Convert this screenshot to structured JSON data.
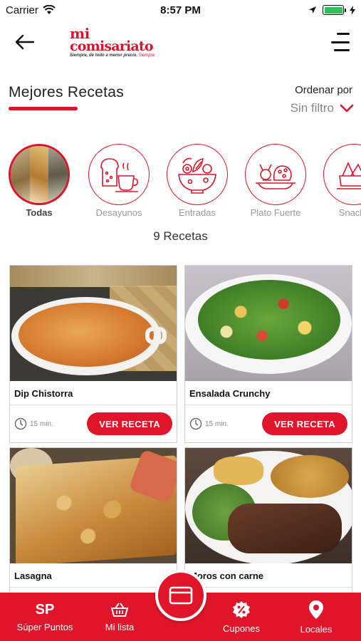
{
  "status_bar": {
    "carrier": "Carrier",
    "time": "8:57 PM",
    "battery_level": 1.0
  },
  "header": {
    "logo_line1": "mi",
    "logo_line2": "comisariato",
    "logo_tagline": "Siempre, de todo a menor precio.",
    "logo_tagline_accent": "Siempre",
    "back_icon": "arrow-left-icon",
    "menu_icon": "menu-icon"
  },
  "section": {
    "title": "Mejores Recetas",
    "sort_label": "Ordenar por",
    "sort_value": "Sin filtro"
  },
  "categories": [
    {
      "label": "Todas",
      "icon": "food-photo",
      "active": true
    },
    {
      "label": "Desayunos",
      "icon": "breakfast-icon",
      "active": false
    },
    {
      "label": "Entradas",
      "icon": "salad-icon",
      "active": false
    },
    {
      "label": "Plato Fuerte",
      "icon": "main-dish-icon",
      "active": false
    },
    {
      "label": "Snacks",
      "icon": "snack-icon",
      "active": false
    }
  ],
  "recipe_count": "9 Recetas",
  "recipes": [
    {
      "name": "Dip Chistorra",
      "time": "15 min.",
      "button": "VER RECETA"
    },
    {
      "name": "Ensalada Crunchy",
      "time": "15 min.",
      "button": "VER RECETA"
    },
    {
      "name": "Lasagna",
      "time": "",
      "button": ""
    },
    {
      "name": "Moros con carne",
      "time": "",
      "button": ""
    }
  ],
  "bottom_nav": {
    "super_puntos_abbr": "SP",
    "super_puntos": "Súper Puntos",
    "mi_lista": "Mi lista",
    "cupones": "Cupones",
    "locales": "Locales"
  },
  "colors": {
    "brand_red": "#e0152a",
    "text_dark": "#222222",
    "text_muted": "#999999"
  }
}
